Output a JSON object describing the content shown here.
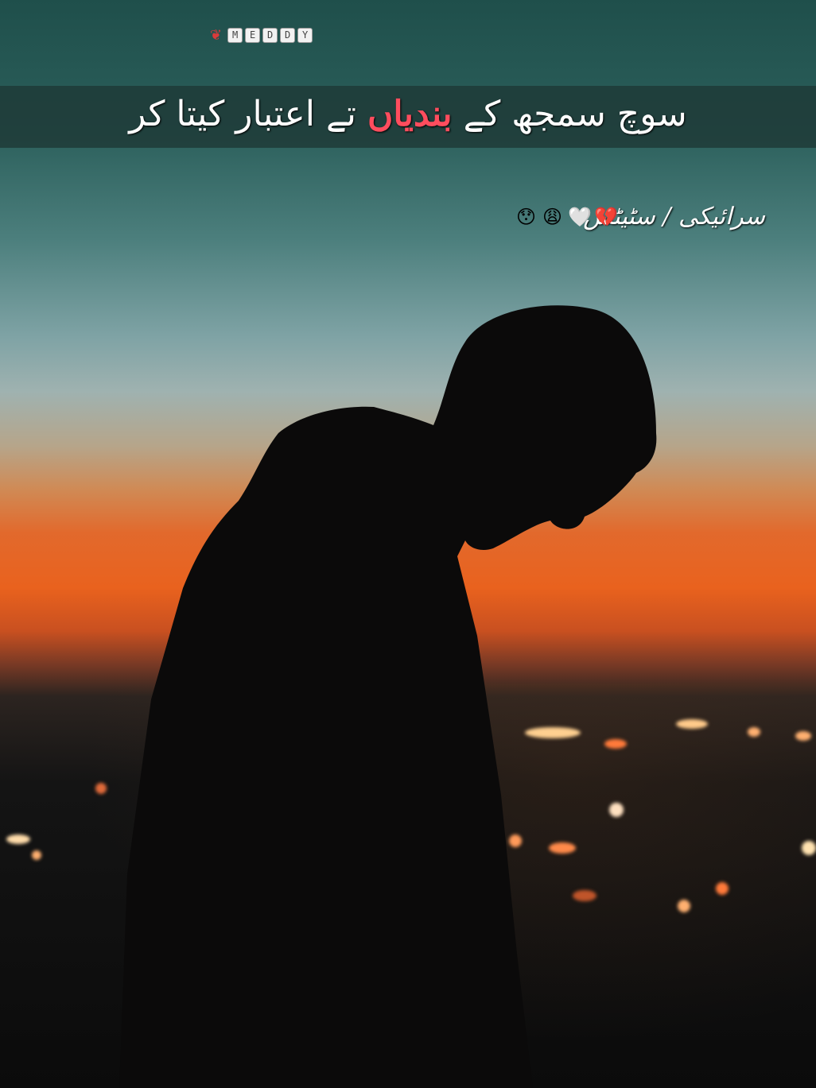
{
  "brand": {
    "icon": "rose-icon",
    "letters": [
      "M",
      "E",
      "D",
      "D",
      "Y"
    ]
  },
  "title": {
    "part1": "سوچ سمجھ کے",
    "highlight": "بندیاں",
    "part2": "تے اعتبار کیتا کر",
    "highlight_color": "#ff4d5e"
  },
  "subtitle": {
    "text": "سرائیکی / سٹیٹس"
  },
  "emojis": [
    "💔",
    "🤍",
    "😩",
    "😯"
  ]
}
